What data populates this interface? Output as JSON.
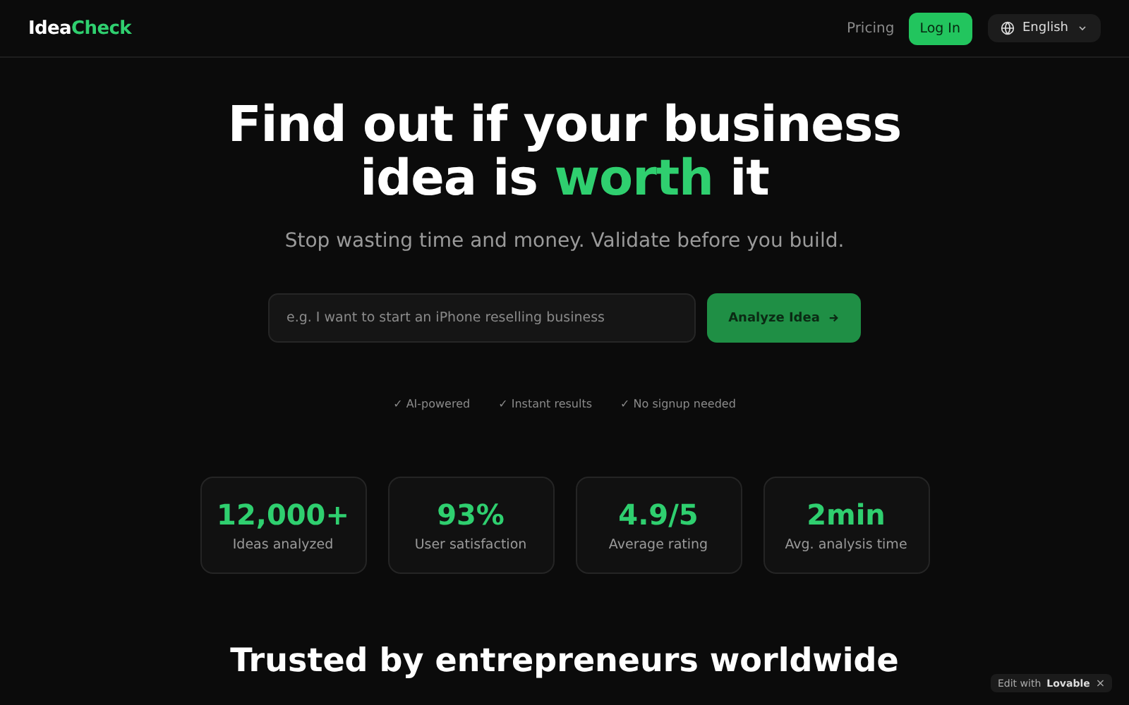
{
  "header": {
    "logo": {
      "first": "Idea",
      "second": "Check"
    },
    "nav": [
      {
        "label": "Pricing",
        "kind": "link"
      },
      {
        "label": "Log In",
        "kind": "button"
      }
    ],
    "language": "English"
  },
  "hero": {
    "title_lines": [
      {
        "text": "Find out if your business"
      },
      {
        "text": "idea is ",
        "highlight": "worth",
        "after": " it"
      }
    ],
    "subtitle": "Stop wasting time and money. Validate before you build.",
    "search": {
      "placeholder": "e.g. I want to start an iPhone reselling business",
      "button": "Analyze Idea"
    },
    "features": [
      "✓ AI-powered",
      "✓ Instant results",
      "✓ No signup needed"
    ]
  },
  "stats": [
    {
      "value": "12,000+",
      "label": "Ideas analyzed"
    },
    {
      "value": "93%",
      "label": "User satisfaction"
    },
    {
      "value": "4.9/5",
      "label": "Average rating"
    },
    {
      "value": "2min",
      "label": "Avg. analysis time"
    }
  ],
  "section_heading": "Trusted by entrepreneurs worldwide",
  "badge": {
    "text": "Edit with",
    "brand": "Lovable",
    "close": "×"
  }
}
